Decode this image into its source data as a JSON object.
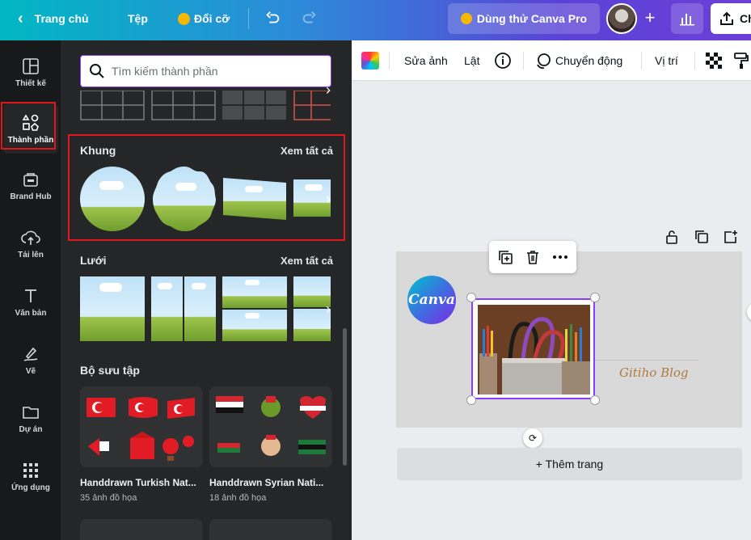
{
  "header": {
    "home": "Trang chủ",
    "file": "Tệp",
    "resize": "Đổi cỡ",
    "try_pro": "Dùng thử Canva Pro",
    "share_partial": "Ch"
  },
  "rail": {
    "items": [
      {
        "label": "Thiết kế",
        "icon": "layout-icon"
      },
      {
        "label": "Thành phần",
        "icon": "elements-icon"
      },
      {
        "label": "Brand Hub",
        "icon": "brand-icon"
      },
      {
        "label": "Tải lên",
        "icon": "upload-cloud-icon"
      },
      {
        "label": "Văn bản",
        "icon": "text-icon"
      },
      {
        "label": "Vẽ",
        "icon": "draw-icon"
      },
      {
        "label": "Dự án",
        "icon": "folder-icon"
      },
      {
        "label": "Ứng dụng",
        "icon": "apps-grid-icon"
      }
    ],
    "active_index": 1
  },
  "panel": {
    "search_placeholder": "Tìm kiếm thành phần",
    "frames": {
      "title": "Khung",
      "see_all": "Xem tất cả"
    },
    "grids": {
      "title": "Lưới",
      "see_all": "Xem tất cả"
    },
    "collections": {
      "title": "Bộ sưu tập",
      "items": [
        {
          "name": "Handdrawn Turkish Nat...",
          "count": "35 ảnh đồ họa"
        },
        {
          "name": "Handdrawn Syrian Nati...",
          "count": "18 ảnh đồ họa"
        }
      ]
    }
  },
  "toolbar": {
    "edit_photo": "Sửa ảnh",
    "flip": "Lật",
    "animate": "Chuyển động",
    "position": "Vị trí"
  },
  "canvas": {
    "logo_text": "Canva",
    "signature": "Gitiho Blog",
    "add_page": "+ Thêm trang"
  },
  "colors": {
    "accent": "#8b3dff",
    "highlight_box": "#e0181e",
    "panel_bg": "#252627",
    "rail_bg": "#18191b"
  }
}
